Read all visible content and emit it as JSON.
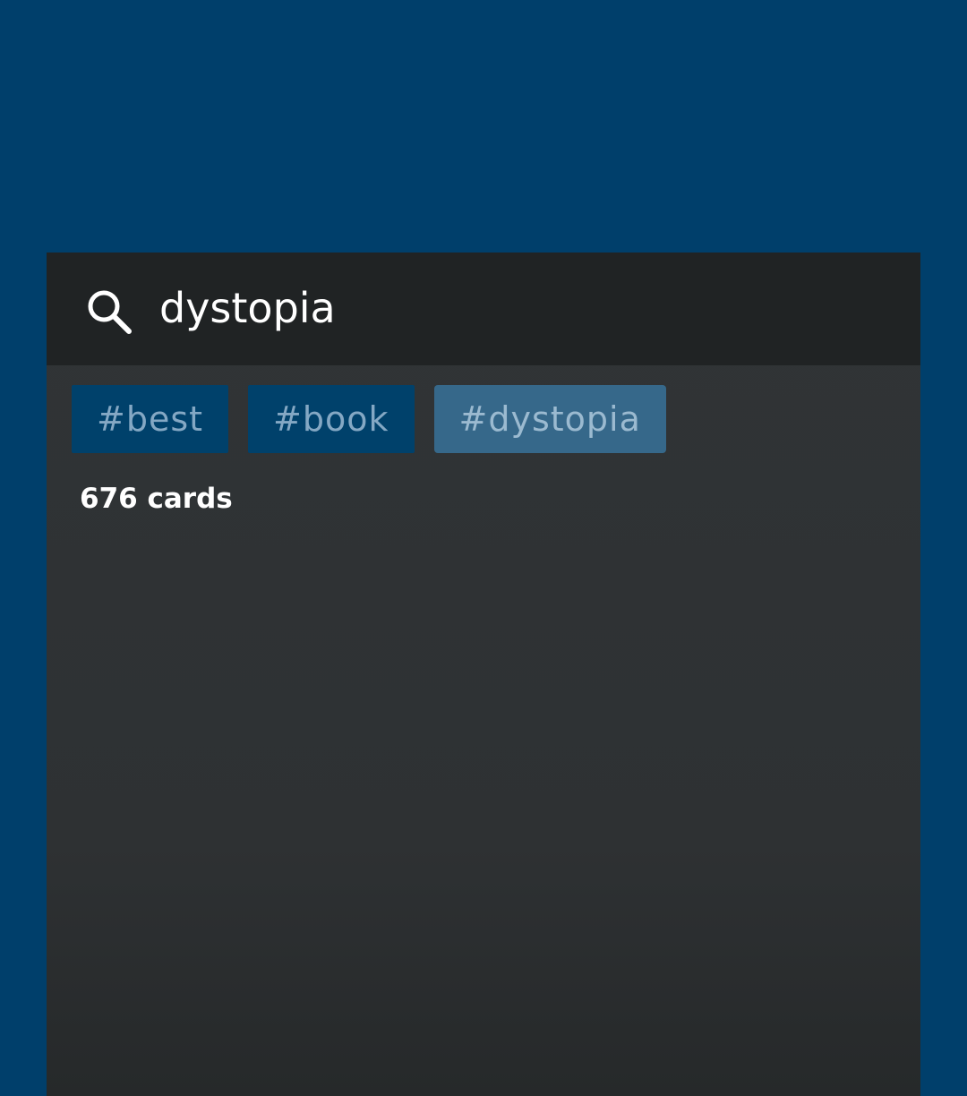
{
  "search": {
    "query": "dystopia",
    "icon": "search-icon"
  },
  "tags": [
    {
      "label": "#best",
      "active": false
    },
    {
      "label": "#book",
      "active": false
    },
    {
      "label": "#dystopia",
      "active": true
    }
  ],
  "results": {
    "count_label": "676 cards"
  },
  "colors": {
    "background": "#003f6b",
    "panel": "#2e3133",
    "search_bar": "#202324",
    "tag": "#00416b",
    "tag_active": "#36688a",
    "tag_text": "#84a8c4"
  }
}
